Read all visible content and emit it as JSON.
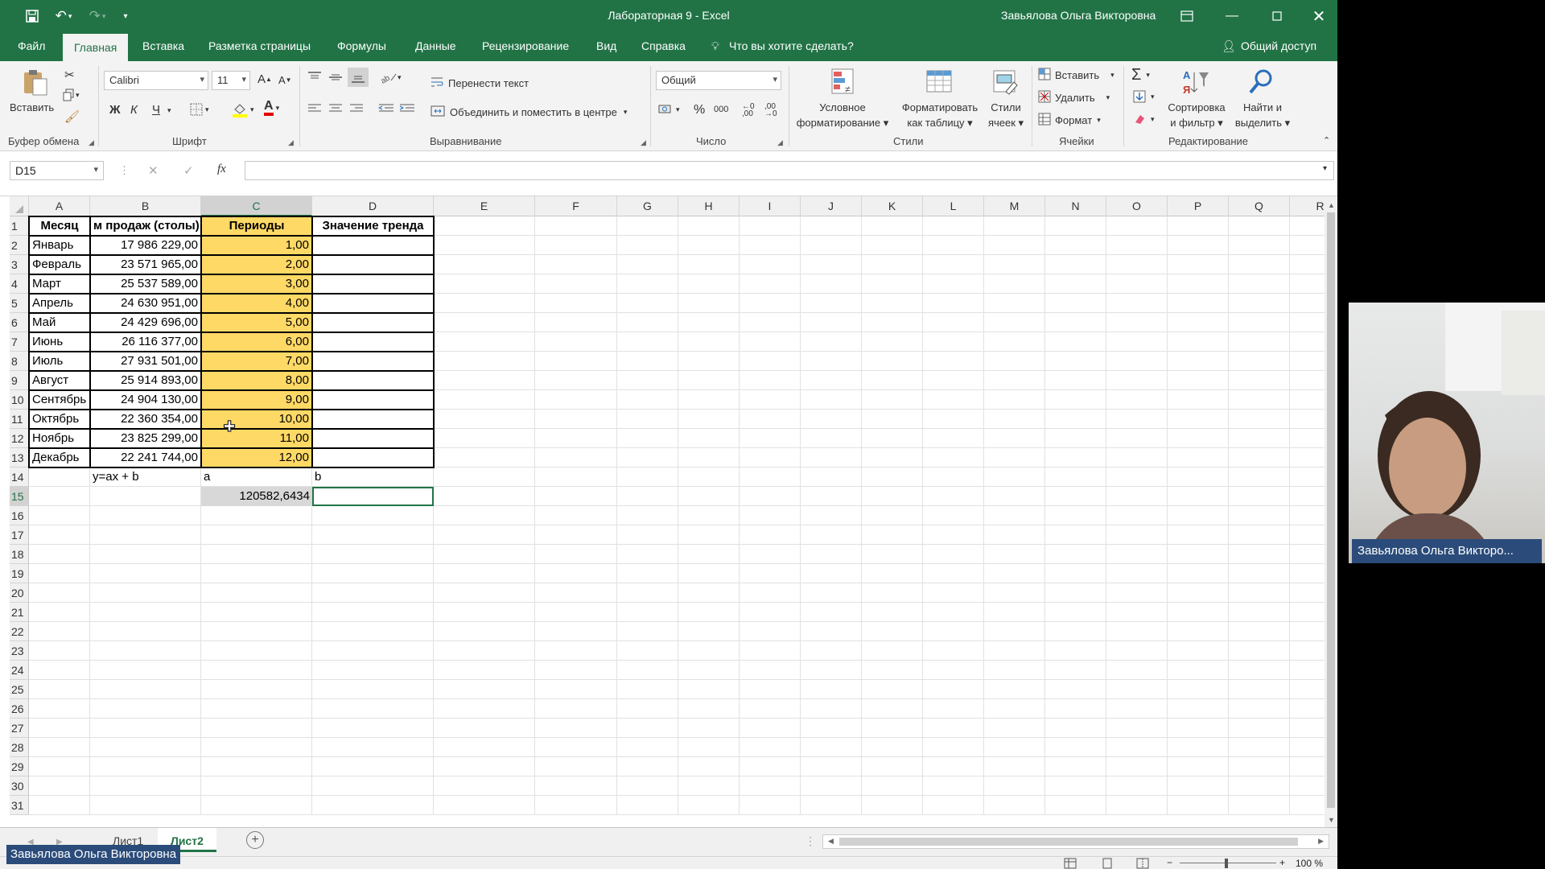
{
  "titlebar": {
    "title": "Лабораторная 9  -  Excel",
    "user": "Завьялова Ольга Викторовна"
  },
  "tabs": [
    {
      "label": "Файл",
      "active": false
    },
    {
      "label": "Главная",
      "active": true
    },
    {
      "label": "Вставка",
      "active": false
    },
    {
      "label": "Разметка страницы",
      "active": false
    },
    {
      "label": "Формулы",
      "active": false
    },
    {
      "label": "Данные",
      "active": false
    },
    {
      "label": "Рецензирование",
      "active": false
    },
    {
      "label": "Вид",
      "active": false
    },
    {
      "label": "Справка",
      "active": false
    }
  ],
  "tellme": "Что вы хотите сделать?",
  "share": "Общий доступ",
  "ribbon": {
    "clipboard": {
      "label": "Буфер обмена",
      "paste": "Вставить"
    },
    "font": {
      "label": "Шрифт",
      "name": "Calibri",
      "size": "11",
      "bold": "Ж",
      "italic": "К",
      "underline": "Ч"
    },
    "alignment": {
      "label": "Выравнивание",
      "wrap": "Перенести текст",
      "merge": "Объединить и поместить в центре"
    },
    "number": {
      "label": "Число",
      "format": "Общий"
    },
    "styles": {
      "label": "Стили",
      "conditional": [
        "Условное",
        "форматирование"
      ],
      "as_table": [
        "Форматировать",
        "как таблицу"
      ],
      "cell_styles": [
        "Стили",
        "ячеек"
      ]
    },
    "cells": {
      "label": "Ячейки",
      "insert": "Вставить",
      "delete": "Удалить",
      "format": "Формат"
    },
    "editing": {
      "label": "Редактирование",
      "sort": [
        "Сортировка",
        "и фильтр"
      ],
      "find": [
        "Найти и",
        "выделить"
      ]
    }
  },
  "formula_bar": {
    "name_box": "D15",
    "fx": "fx",
    "value": ""
  },
  "columns": [
    "A",
    "B",
    "C",
    "D",
    "E",
    "F",
    "G",
    "H",
    "I",
    "J",
    "K",
    "L",
    "M",
    "N",
    "O",
    "P",
    "Q",
    "R"
  ],
  "selected_column": "C",
  "rows": [
    "1",
    "2",
    "3",
    "4",
    "5",
    "6",
    "7",
    "8",
    "9",
    "10",
    "11",
    "12",
    "13",
    "14",
    "15",
    "16",
    "17",
    "18",
    "19",
    "20",
    "21",
    "22",
    "23",
    "24",
    "25",
    "26",
    "27",
    "28",
    "29",
    "30",
    "31"
  ],
  "selected_row": "15",
  "table": {
    "headers": {
      "a": "Месяц",
      "b": "м продаж (столы)",
      "c": "Периоды",
      "d": "Значение тренда"
    },
    "data": [
      {
        "a": "Январь",
        "b": "17 986 229,00",
        "c": "1,00"
      },
      {
        "a": "Февраль",
        "b": "23 571 965,00",
        "c": "2,00"
      },
      {
        "a": "Март",
        "b": "25 537 589,00",
        "c": "3,00"
      },
      {
        "a": "Апрель",
        "b": "24 630 951,00",
        "c": "4,00"
      },
      {
        "a": "Май",
        "b": "24 429 696,00",
        "c": "5,00"
      },
      {
        "a": "Июнь",
        "b": "26 116 377,00",
        "c": "6,00"
      },
      {
        "a": "Июль",
        "b": "27 931 501,00",
        "c": "7,00"
      },
      {
        "a": "Август",
        "b": "25 914 893,00",
        "c": "8,00"
      },
      {
        "a": "Сентябрь",
        "b": "24 904 130,00",
        "c": "9,00"
      },
      {
        "a": "Октябрь",
        "b": "22 360 354,00",
        "c": "10,00"
      },
      {
        "a": "Ноябрь",
        "b": "23 825 299,00",
        "c": "11,00"
      },
      {
        "a": "Декабрь",
        "b": "22 241 744,00",
        "c": "12,00"
      }
    ],
    "row14": {
      "b": "y=ax + b",
      "c": "a",
      "d": "b"
    },
    "row15": {
      "c": "120582,6434"
    }
  },
  "sheets": [
    {
      "name": "Лист1",
      "active": false
    },
    {
      "name": "Лист2",
      "active": true
    }
  ],
  "zoom": "100 %",
  "video": {
    "participant_label": "Завьялова Ольга Викторо...",
    "host_label": "Завьялова Ольга Викторовна"
  },
  "colors": {
    "excel_green": "#217346",
    "highlight": "#ffd966",
    "zoom_label_bg": "#2b4c7a"
  }
}
